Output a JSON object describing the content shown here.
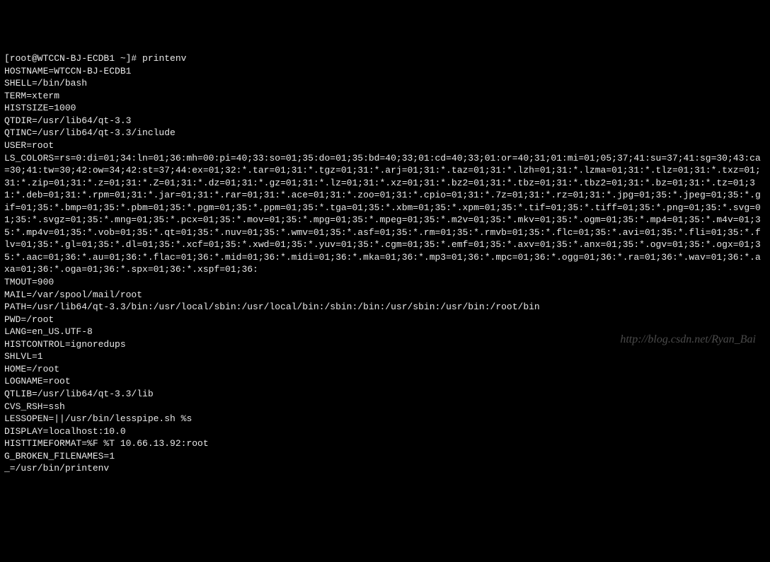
{
  "prompt": "[root@WTCCN-BJ-ECDB1 ~]# ",
  "command": "printenv",
  "env": {
    "HOSTNAME": "WTCCN-BJ-ECDB1",
    "SHELL": "/bin/bash",
    "TERM": "xterm",
    "HISTSIZE": "1000",
    "QTDIR": "/usr/lib64/qt-3.3",
    "QTINC": "/usr/lib64/qt-3.3/include",
    "USER": "root",
    "LS_COLORS": "rs=0:di=01;34:ln=01;36:mh=00:pi=40;33:so=01;35:do=01;35:bd=40;33;01:cd=40;33;01:or=40;31;01:mi=01;05;37;41:su=37;41:sg=30;43:ca=30;41:tw=30;42:ow=34;42:st=37;44:ex=01;32:*.tar=01;31:*.tgz=01;31:*.arj=01;31:*.taz=01;31:*.lzh=01;31:*.lzma=01;31:*.tlz=01;31:*.txz=01;31:*.zip=01;31:*.z=01;31:*.Z=01;31:*.dz=01;31:*.gz=01;31:*.lz=01;31:*.xz=01;31:*.bz2=01;31:*.tbz=01;31:*.tbz2=01;31:*.bz=01;31:*.tz=01;31:*.deb=01;31:*.rpm=01;31:*.jar=01;31:*.rar=01;31:*.ace=01;31:*.zoo=01;31:*.cpio=01;31:*.7z=01;31:*.rz=01;31:*.jpg=01;35:*.jpeg=01;35:*.gif=01;35:*.bmp=01;35:*.pbm=01;35:*.pgm=01;35:*.ppm=01;35:*.tga=01;35:*.xbm=01;35:*.xpm=01;35:*.tif=01;35:*.tiff=01;35:*.png=01;35:*.svg=01;35:*.svgz=01;35:*.mng=01;35:*.pcx=01;35:*.mov=01;35:*.mpg=01;35:*.mpeg=01;35:*.m2v=01;35:*.mkv=01;35:*.ogm=01;35:*.mp4=01;35:*.m4v=01;35:*.mp4v=01;35:*.vob=01;35:*.qt=01;35:*.nuv=01;35:*.wmv=01;35:*.asf=01;35:*.rm=01;35:*.rmvb=01;35:*.flc=01;35:*.avi=01;35:*.fli=01;35:*.flv=01;35:*.gl=01;35:*.dl=01;35:*.xcf=01;35:*.xwd=01;35:*.yuv=01;35:*.cgm=01;35:*.emf=01;35:*.axv=01;35:*.anx=01;35:*.ogv=01;35:*.ogx=01;35:*.aac=01;36:*.au=01;36:*.flac=01;36:*.mid=01;36:*.midi=01;36:*.mka=01;36:*.mp3=01;36:*.mpc=01;36:*.ogg=01;36:*.ra=01;36:*.wav=01;36:*.axa=01;36:*.oga=01;36:*.spx=01;36:*.xspf=01;36:",
    "TMOUT": "900",
    "MAIL": "/var/spool/mail/root",
    "PATH": "/usr/lib64/qt-3.3/bin:/usr/local/sbin:/usr/local/bin:/sbin:/bin:/usr/sbin:/usr/bin:/root/bin",
    "PWD": "/root",
    "LANG": "en_US.UTF-8",
    "HISTCONTROL": "ignoredups",
    "SHLVL": "1",
    "HOME": "/root",
    "LOGNAME": "root",
    "QTLIB": "/usr/lib64/qt-3.3/lib",
    "CVS_RSH": "ssh",
    "LESSOPEN": "||/usr/bin/lesspipe.sh %s",
    "DISPLAY": "localhost:10.0",
    "HISTTIMEFORMAT": "%F %T 10.66.13.92:root",
    "G_BROKEN_FILENAMES": "1",
    "_": "/usr/bin/printenv"
  },
  "env_order": [
    "HOSTNAME",
    "SHELL",
    "TERM",
    "HISTSIZE",
    "QTDIR",
    "QTINC",
    "USER",
    "LS_COLORS",
    "TMOUT",
    "MAIL",
    "PATH",
    "PWD",
    "LANG",
    "HISTCONTROL",
    "SHLVL",
    "HOME",
    "LOGNAME",
    "QTLIB",
    "CVS_RSH",
    "LESSOPEN",
    "DISPLAY",
    "HISTTIMEFORMAT",
    "G_BROKEN_FILENAMES",
    "_"
  ],
  "watermark": "http://blog.csdn.net/Ryan_Bai"
}
